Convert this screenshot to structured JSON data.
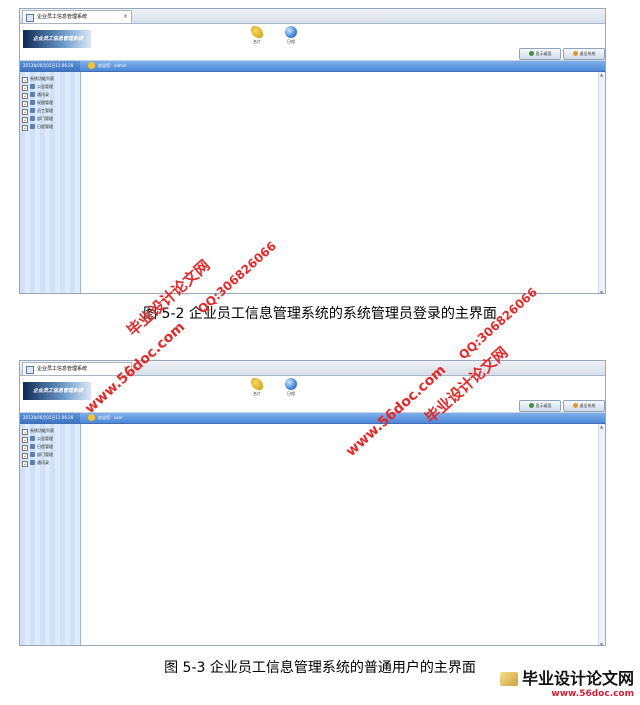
{
  "screens": [
    {
      "tab_title": "企业员工信息管理系统",
      "logo_text": "企业员工信息管理系统",
      "tools": [
        "名片",
        "日程"
      ],
      "buttons": [
        "显示桌面",
        "退出系统"
      ],
      "date": "2013年06月02日11:06:28",
      "welcome": "欢迎您：admin",
      "tree": [
        "系统功能列表",
        "公告管理",
        "通讯录",
        "权限管理",
        "员工管理",
        "部门管理",
        "日程管理"
      ]
    },
    {
      "tab_title": "企业员工信息管理系统",
      "logo_text": "企业员工信息管理系统",
      "tools": [
        "名片",
        "日程"
      ],
      "buttons": [
        "显示桌面",
        "退出系统"
      ],
      "date": "2013年06月02日11:06:28",
      "welcome": "欢迎您：user",
      "tree": [
        "系统功能列表",
        "公告管理",
        "日程管理",
        "部门管理",
        "通讯录"
      ]
    }
  ],
  "captions": {
    "first": "图 5-2 企业员工信息管理系统的系统管理员登录的主界面",
    "second": "图 5-3 企业员工信息管理系统的普通用户的主界面"
  },
  "watermark": {
    "site": "www.56doc.com",
    "name": "毕业设计论文网",
    "qq": "QQ:306826066"
  },
  "footer": {
    "name": "毕业设计论文网",
    "url": "www.56doc.com"
  }
}
